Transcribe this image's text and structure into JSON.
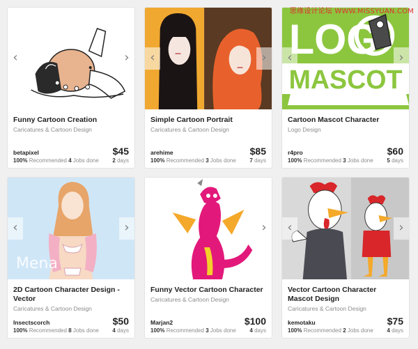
{
  "watermark": "思缘设计论坛 WWW.MISSYUAN.COM",
  "arrows": {
    "prev": "‹",
    "next": "›"
  },
  "cards": [
    {
      "title": "Funny Cartoon Creation",
      "category": "Caricatures & Cartoon Design",
      "seller": "betapixel",
      "price": "$45",
      "recommended": "100%",
      "recommended_label": "Recommended",
      "jobs": "4",
      "jobs_label": "Jobs done",
      "days": "2",
      "days_label": "days"
    },
    {
      "title": "Simple Cartoon Portrait",
      "category": "Caricatures & Cartoon Design",
      "seller": "arehime",
      "price": "$85",
      "recommended": "100%",
      "recommended_label": "Recommended",
      "jobs": "3",
      "jobs_label": "Jobs done",
      "days": "7",
      "days_label": "days"
    },
    {
      "title": "Cartoon Mascot Character",
      "category": "Logo Design",
      "seller": "r4pro",
      "price": "$60",
      "recommended": "100%",
      "recommended_label": "Recommended",
      "jobs": "3",
      "jobs_label": "Jobs done",
      "days": "5",
      "days_label": "days",
      "image_text": {
        "line1": "LOG",
        "line2": "MASCOT"
      }
    },
    {
      "title": "2D Cartoon Character Design - Vector",
      "category": "Caricatures & Cartoon Design",
      "seller": "Insectscorch",
      "price": "$50",
      "recommended": "100%",
      "recommended_label": "Recommended",
      "jobs": "8",
      "jobs_label": "Jobs done",
      "days": "4",
      "days_label": "days",
      "image_text": "Mena"
    },
    {
      "title": "Funny Vector Cartoon Character",
      "category": "Caricatures & Cartoon Design",
      "seller": "Marjan2",
      "price": "$100",
      "recommended": "100%",
      "recommended_label": "Recommended",
      "jobs": "3",
      "jobs_label": "Jobs done",
      "days": "4",
      "days_label": "days"
    },
    {
      "title": "Vector Cartoon Character Mascot Design",
      "category": "Caricatures & Cartoon Design",
      "seller": "kemotaku",
      "price": "$75",
      "recommended": "100%",
      "recommended_label": "Recommended",
      "jobs": "2",
      "jobs_label": "Jobs done",
      "days": "4",
      "days_label": "days"
    }
  ],
  "colors": {
    "mascot_green": "#8cc63f",
    "portrait_orange": "#f0a830",
    "portrait_brown": "#5a3a22",
    "vector_blue": "#cfe6f7",
    "rooster_red": "#d8262a"
  }
}
